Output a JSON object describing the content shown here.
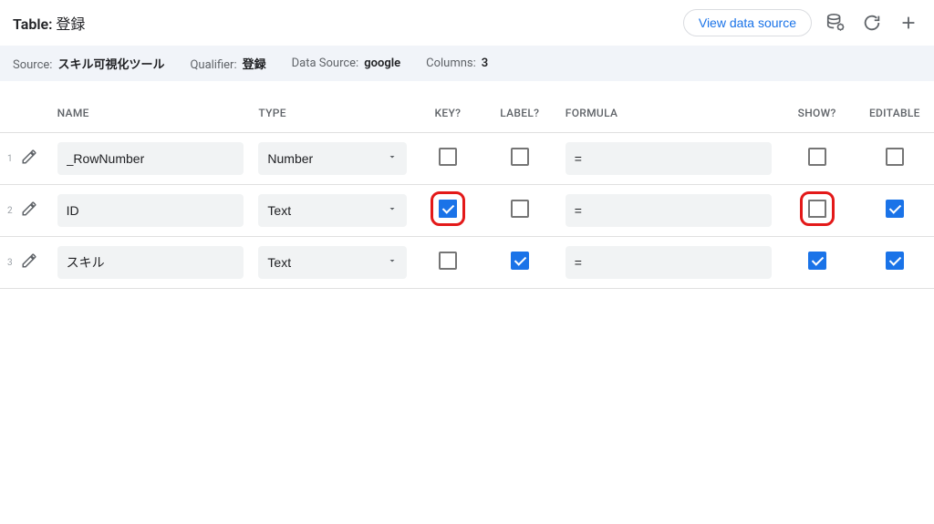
{
  "header": {
    "title_prefix": "Table:",
    "title_name": "登録",
    "view_source_label": "View data source"
  },
  "meta": {
    "source_label": "Source:",
    "source_value": "スキル可視化ツール",
    "qualifier_label": "Qualifier:",
    "qualifier_value": "登録",
    "datasource_label": "Data Source:",
    "datasource_value": "google",
    "columns_label": "Columns:",
    "columns_value": "3"
  },
  "columns": {
    "name": "NAME",
    "type": "TYPE",
    "key": "KEY?",
    "label": "LABEL?",
    "formula": "FORMULA",
    "show": "SHOW?",
    "editable": "EDITABLE"
  },
  "rows": [
    {
      "num": "1",
      "name": "_RowNumber",
      "type": "Number",
      "key": false,
      "label": false,
      "formula": "=",
      "show": false,
      "editable": false,
      "hl_key": false,
      "hl_show": false
    },
    {
      "num": "2",
      "name": "ID",
      "type": "Text",
      "key": true,
      "label": false,
      "formula": "=",
      "show": false,
      "editable": true,
      "hl_key": true,
      "hl_show": true
    },
    {
      "num": "3",
      "name": "スキル",
      "type": "Text",
      "key": false,
      "label": true,
      "formula": "=",
      "show": true,
      "editable": true,
      "hl_key": false,
      "hl_show": false
    }
  ]
}
